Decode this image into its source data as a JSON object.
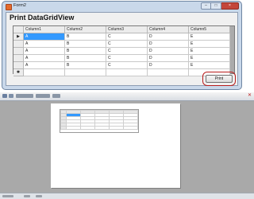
{
  "window": {
    "title": "Form2",
    "heading": "Print DataGridView",
    "print_button_label": "Print"
  },
  "grid": {
    "columns": [
      "Column1",
      "Column2",
      "Column3",
      "Column4",
      "Column5"
    ],
    "rows": [
      [
        "A",
        "B",
        "C",
        "D",
        "E"
      ],
      [
        "A",
        "B",
        "C",
        "D",
        "E"
      ],
      [
        "A",
        "B",
        "C",
        "D",
        "E"
      ],
      [
        "A",
        "B",
        "C",
        "D",
        "E"
      ],
      [
        "A",
        "B",
        "C",
        "D",
        "E"
      ]
    ],
    "current_row_marker": "▶",
    "new_row_marker": "✱"
  },
  "icons": {
    "app": "form-app-icon",
    "minimize": "minimize-icon",
    "maximize": "maximize-icon",
    "close": "close-icon"
  },
  "colors": {
    "selection": "#3399ff",
    "highlight_box": "#b81c1c"
  }
}
